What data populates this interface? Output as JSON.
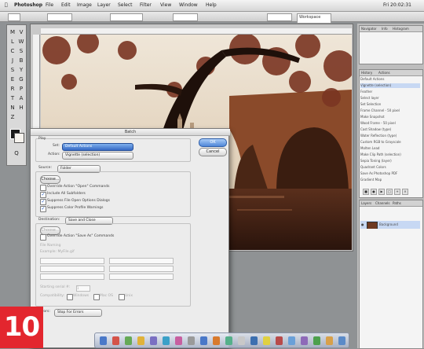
{
  "menubar": {
    "app_name": "Photoshop",
    "items": [
      "File",
      "Edit",
      "Image",
      "Layer",
      "Select",
      "Filter",
      "View",
      "Window",
      "Help"
    ],
    "clock": "Fri 20:02:31",
    "window_label": "Window"
  },
  "options_bar": {
    "workspace_label": "Workspace"
  },
  "toolbox": {
    "tools": [
      "M",
      "V",
      "L",
      "W",
      "C",
      "S",
      "J",
      "B",
      "S",
      "Y",
      "E",
      "G",
      "R",
      "P",
      "T",
      "A",
      "N",
      "H",
      "Z",
      "Q"
    ]
  },
  "dialog": {
    "title": "Batch",
    "play": {
      "section_label": "Play",
      "set_label": "Set:",
      "set_value": "Default Actions",
      "action_label": "Action:",
      "action_value": "Vignette (selection)"
    },
    "source": {
      "label": "Source:",
      "value": "Folder",
      "choose_button": "Choose...",
      "override_open": "Override Action \"Open\" Commands",
      "include_subfolders": "Include All Subfolders",
      "suppress_file_open": "Suppress File Open Options Dialogs",
      "suppress_color_profile": "Suppress Color Profile Warnings"
    },
    "destination": {
      "label": "Destination:",
      "value": "Save and Close",
      "choose_button": "Choose...",
      "override_save": "Override Action \"Save As\" Commands",
      "file_naming_label": "File Naming",
      "example_label": "Example: MyFile.gif",
      "serial_label": "Starting serial #:",
      "serial_value": "1",
      "compat_label": "Compatibility:",
      "compat_windows": "Windows",
      "compat_macos": "Mac OS",
      "compat_unix": "Unix"
    },
    "errors": {
      "label": "Errors:",
      "value": "Stop For Errors"
    },
    "buttons": {
      "ok": "OK",
      "cancel": "Cancel"
    }
  },
  "panels": {
    "top_tabs": [
      "Navigator",
      "Info",
      "Histogram"
    ],
    "actions_tabs": [
      "History",
      "Actions"
    ],
    "actions_items": [
      "Default Actions",
      "Vignette (selection)",
      "Feather",
      "Select layer",
      "Set Selection",
      "Frame Channel - 50 pixel",
      "Make Snapshot",
      "Wood Frame - 50 pixel",
      "Cast Shadow (type)",
      "Water Reflection (type)",
      "Custom RGB to Grayscale",
      "Molten Lead",
      "Make Clip Path (selection)",
      "Sepia Toning (layer)",
      "Quadrant Colors",
      "Save As Photoshop PDF",
      "Gradient Map"
    ],
    "layers_tabs": [
      "Layers",
      "Channels",
      "Paths"
    ],
    "layer_name": "Background"
  },
  "dock": {
    "icon_colors": [
      "#4a78c8",
      "#d4534a",
      "#65a957",
      "#e0b23a",
      "#7a6fc2",
      "#3aa0c8",
      "#c75fa0",
      "#9a9a9a",
      "#4a78c8",
      "#d87a2e",
      "#55b08a",
      "#c8c8c8",
      "#3c6fb0",
      "#e0d040",
      "#b84a4a",
      "#6aa0d8",
      "#8e6ab8",
      "#4da04d",
      "#d8a04a",
      "#5a8ac8"
    ]
  },
  "badge": {
    "step": "10"
  },
  "colors": {
    "badge": "#e3262e",
    "selection": "#3569c4",
    "photo_tint": "#8a4a2a"
  }
}
